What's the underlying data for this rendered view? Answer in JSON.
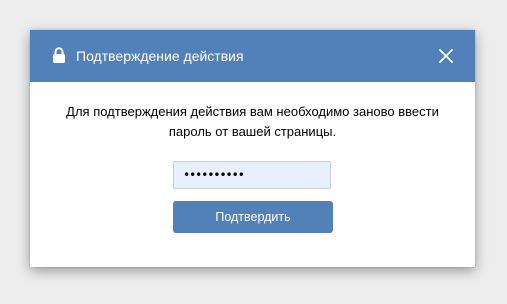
{
  "dialog": {
    "title": "Подтверждение действия",
    "header_color": "#5181b8",
    "message": "Для подтверждения действия вам необходимо заново ввести пароль от вашей страницы.",
    "password_field": {
      "value": "••••••••••"
    },
    "confirm_label": "Подтвердить",
    "icons": {
      "header": "lock-icon",
      "close": "close-icon"
    }
  }
}
